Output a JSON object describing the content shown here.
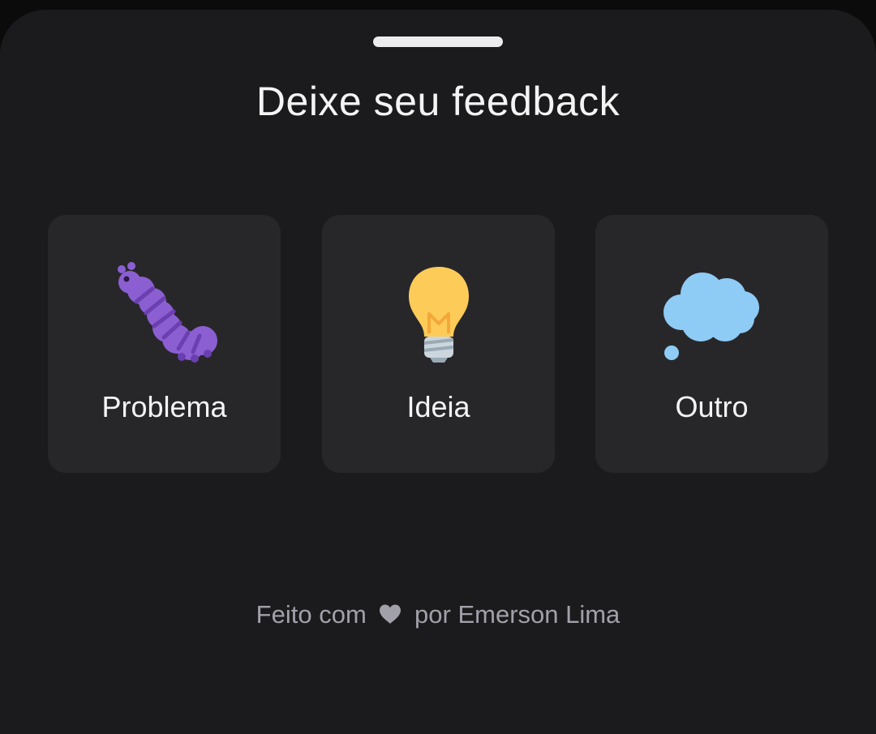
{
  "header": {
    "title": "Deixe seu feedback"
  },
  "options": [
    {
      "label": "Problema",
      "icon": "caterpillar-icon",
      "color": "#8b5fd1"
    },
    {
      "label": "Ideia",
      "icon": "lightbulb-icon",
      "color": "#fdcb58"
    },
    {
      "label": "Outro",
      "icon": "thought-balloon-icon",
      "color": "#8ecbf5"
    }
  ],
  "footer": {
    "prefix": "Feito com",
    "icon": "heart-icon",
    "suffix": "por Emerson Lima"
  },
  "colors": {
    "background": "#1b1b1d",
    "card": "#27272a",
    "text": "#f4f4f5",
    "muted": "#a1a1aa"
  }
}
